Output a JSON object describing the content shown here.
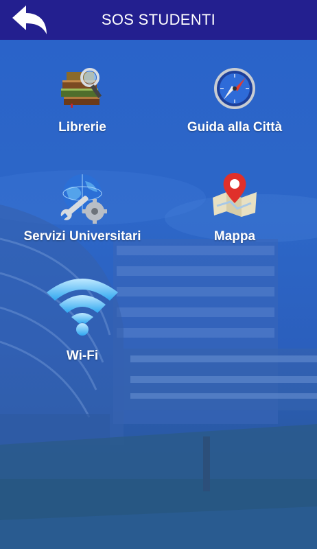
{
  "header": {
    "title": "SOS STUDENTI",
    "back_icon": "back-arrow-icon",
    "background": "#231f8f"
  },
  "menu": [
    {
      "label": "Librerie",
      "icon": "books-icon"
    },
    {
      "label": "Guida alla Città",
      "icon": "compass-icon"
    },
    {
      "label": "Servizi Universitari",
      "icon": "globe-wrench-icon"
    },
    {
      "label": "Mappa",
      "icon": "map-pin-icon"
    },
    {
      "label": "Wi-Fi",
      "icon": "wifi-icon"
    }
  ],
  "colors": {
    "background_blue": "#2a63c9",
    "text": "#ffffff"
  }
}
